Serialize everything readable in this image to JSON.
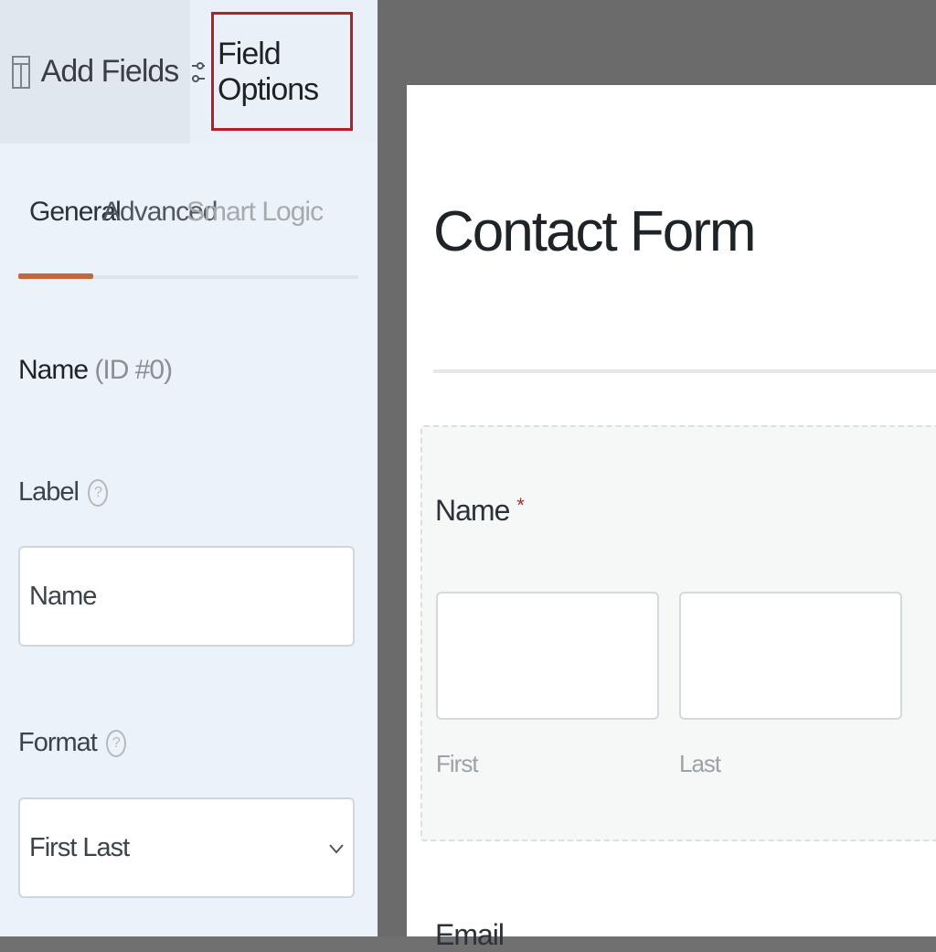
{
  "top_tabs": {
    "add_fields": "Add Fields",
    "field_options": "Field Options"
  },
  "subtabs": {
    "general": "General",
    "advanced": "Advanced",
    "smart_logic": "Smart Logic"
  },
  "field": {
    "name": "Name",
    "id_text": "(ID #0)"
  },
  "options": {
    "label_title": "Label",
    "label_value": "Name",
    "format_title": "Format",
    "format_value": "First Last",
    "help_glyph": "?"
  },
  "preview": {
    "form_title": "Contact Form",
    "name_field_label": "Name",
    "required_mark": "*",
    "first_sublabel": "First",
    "last_sublabel": "Last",
    "next_field_label": "Email"
  },
  "colors": {
    "highlight_border": "#b81f25",
    "active_tab_underline": "#c4673a"
  },
  "icons": {
    "add_fields": "table-icon",
    "field_options": "sliders-icon",
    "help": "help-circle-icon",
    "select": "chevron-down-icon"
  }
}
